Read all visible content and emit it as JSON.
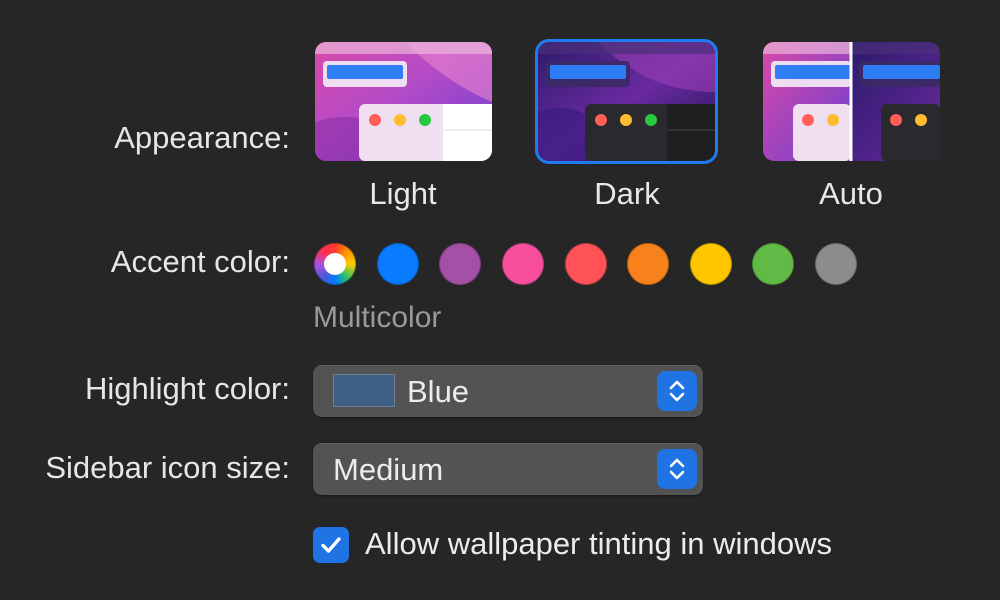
{
  "appearance": {
    "label": "Appearance:",
    "options": [
      {
        "name": "Light",
        "selected": false
      },
      {
        "name": "Dark",
        "selected": true
      },
      {
        "name": "Auto",
        "selected": false
      }
    ]
  },
  "accent": {
    "label": "Accent color:",
    "selected_name": "Multicolor",
    "colors": [
      {
        "name": "multicolor",
        "hex": "multicolor"
      },
      {
        "name": "blue",
        "hex": "#0a7aff"
      },
      {
        "name": "purple",
        "hex": "#a550a7"
      },
      {
        "name": "pink",
        "hex": "#f74f9e"
      },
      {
        "name": "red",
        "hex": "#ff5257"
      },
      {
        "name": "orange",
        "hex": "#f7821b"
      },
      {
        "name": "yellow",
        "hex": "#ffc600"
      },
      {
        "name": "green",
        "hex": "#62ba46"
      },
      {
        "name": "graphite",
        "hex": "#8c8c8c"
      }
    ]
  },
  "highlight": {
    "label": "Highlight color:",
    "value": "Blue",
    "chip_color": "#3f5f85"
  },
  "sidebar_icon_size": {
    "label": "Sidebar icon size:",
    "value": "Medium"
  },
  "wallpaper_tinting": {
    "label": "Allow wallpaper tinting in windows",
    "checked": true
  },
  "colors": {
    "accent_blue": "#1f73e2",
    "background": "#262626",
    "popup_bg": "#535353"
  }
}
